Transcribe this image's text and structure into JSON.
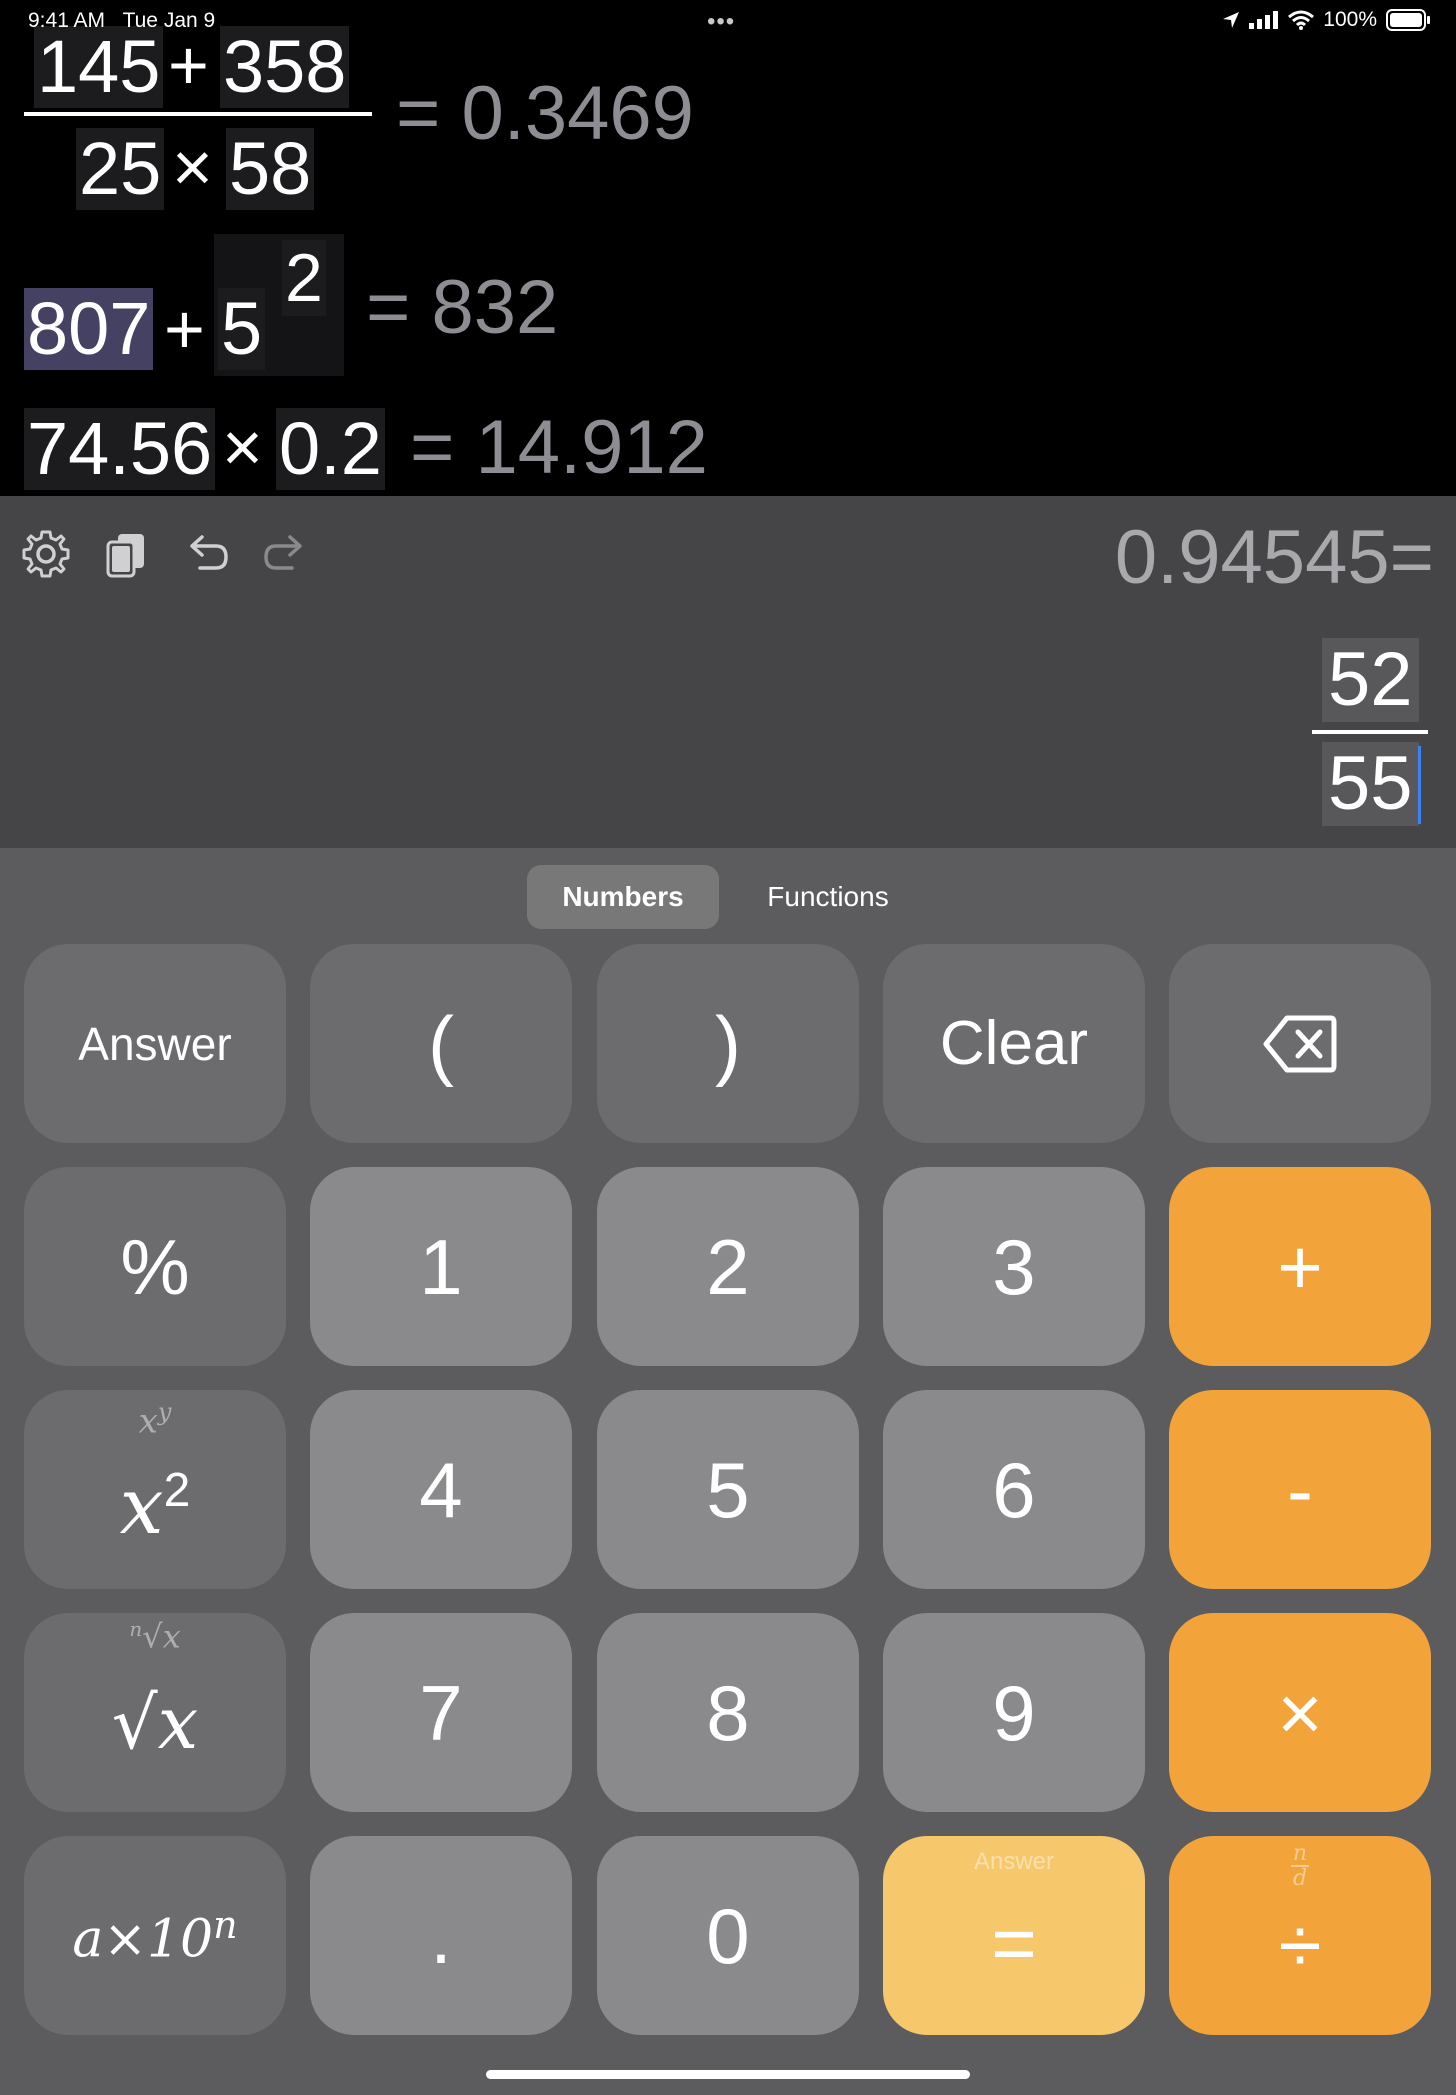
{
  "status_bar": {
    "time": "9:41 AM",
    "date": "Tue Jan 9",
    "center_dots": "•••",
    "battery": "100%"
  },
  "history": [
    {
      "numerator_a": "145",
      "numerator_op": "+",
      "numerator_b": "358",
      "denominator_a": "25",
      "denominator_op": "×",
      "denominator_b": "58",
      "result": "= 0.3469"
    },
    {
      "base_a": "807",
      "op": "+",
      "base_b": "5",
      "exponent": "2",
      "result": "= 832"
    },
    {
      "a": "74.56",
      "op": "×",
      "b": "0.2",
      "result": "= 14.912"
    }
  ],
  "editor": {
    "preview": "0.94545=",
    "numerator": "52",
    "denominator": "55"
  },
  "tabs": [
    {
      "label": "Numbers",
      "active": true
    },
    {
      "label": "Functions",
      "active": false
    }
  ],
  "keys": {
    "answer": "Answer",
    "lparen": "(",
    "rparen": ")",
    "clear": "Clear",
    "percent": "%",
    "one": "1",
    "two": "2",
    "three": "3",
    "four": "4",
    "five": "5",
    "six": "6",
    "seven": "7",
    "eight": "8",
    "nine": "9",
    "zero": "0",
    "dot": ".",
    "plus": "+",
    "minus": "-",
    "times": "×",
    "divide": "÷",
    "equals": "=",
    "equals_sub": "Answer",
    "power_main": "x",
    "power_main_exp": "2",
    "power_sub": "x",
    "power_sub_exp": "y",
    "root_main": "√x",
    "root_sub_index": "n",
    "root_sub": "√x",
    "sci_main": "a×10",
    "sci_exp": "n",
    "frac_sub_n": "n",
    "frac_sub_d": "d"
  }
}
